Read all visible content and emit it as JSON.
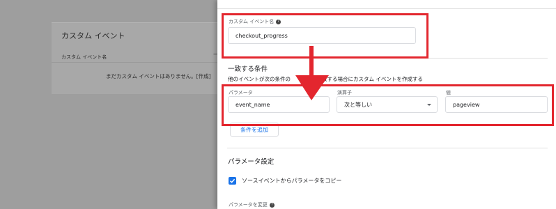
{
  "background": {
    "card_title": "カスタム イベント",
    "column_header": "カスタム イベント名",
    "column_dash": "—",
    "empty_message": "まだカスタム イベントはありません。[作成]"
  },
  "drawer": {
    "custom_event_name": {
      "label": "カスタム イベント名",
      "value": "checkout_progress"
    },
    "conditions": {
      "heading": "一致する条件",
      "description": "他のイベントが次の条件の　　　　　一致する場合にカスタム イベントを作成する",
      "parameter_label": "パラメータ",
      "parameter_value": "event_name",
      "operator_label": "演算子",
      "operator_value": "次と等しい",
      "value_label": "値",
      "value_value": "pageview",
      "add_condition": "条件を追加"
    },
    "parameter_settings": {
      "heading": "パラメータ設定",
      "copy_checkbox_label": "ソースイベントからパラメータをコピー",
      "copy_checked": true,
      "modify_label": "パラメータを変更"
    }
  },
  "colors": {
    "annotation_red": "#e3262e",
    "accent_blue": "#1a73e8",
    "overlay_gray": "#9e9e9e"
  },
  "icons": {
    "help": "help-circle-icon",
    "dropdown": "triangle-down-icon",
    "check": "check-icon",
    "arrow": "arrow-down-icon"
  }
}
